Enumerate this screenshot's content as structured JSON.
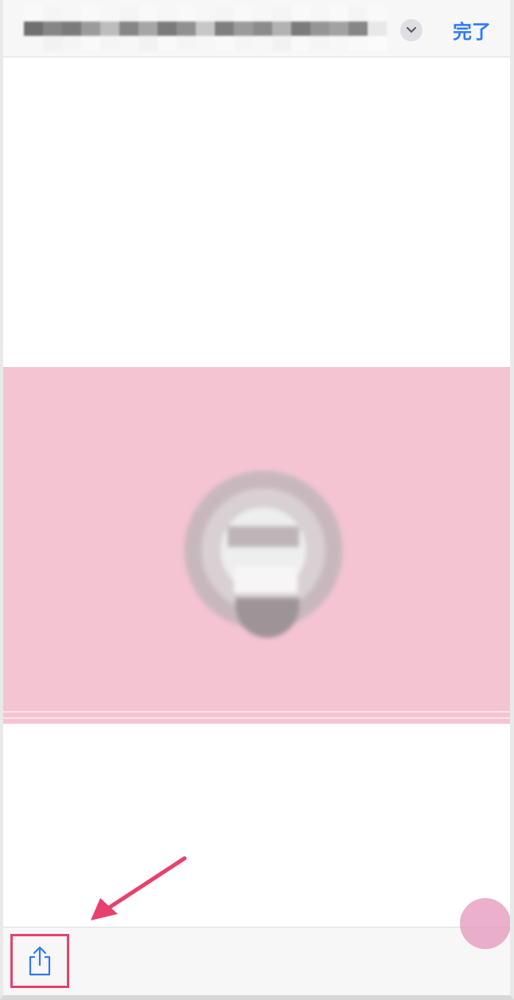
{
  "header": {
    "done_label": "完了",
    "expand_icon": "chevron-down-icon"
  },
  "toolbar": {
    "share_icon": "share-icon"
  },
  "colors": {
    "accent": "#2f7af5",
    "banner": "#f5c4d2",
    "highlight": "#e8416f",
    "touch": "#e496b9"
  }
}
